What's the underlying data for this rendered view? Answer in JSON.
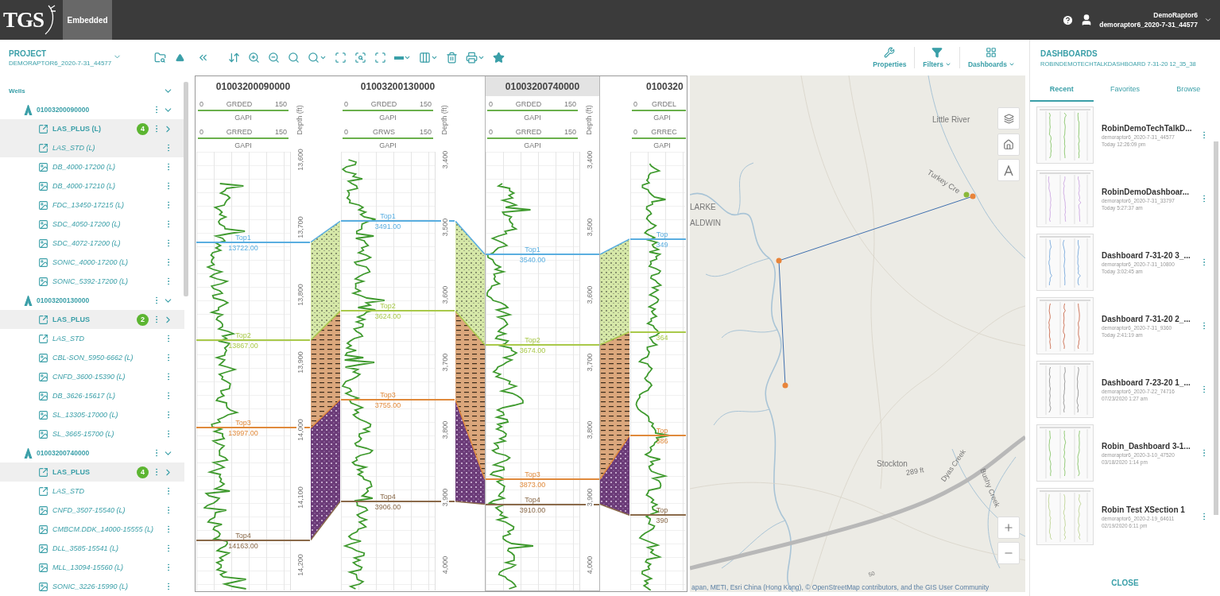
{
  "header": {
    "logo": "TGS",
    "tab": {
      "label": "Embedded",
      "selected": true
    },
    "user": {
      "name": "DemoRaptor6",
      "account": "demoraptor6_2020-7-31_44577"
    }
  },
  "sidebar": {
    "title": "PROJECT",
    "subtitle": "DEMORAPTOR6_2020-7-31_44577",
    "group": {
      "label": "Wells",
      "expanded": true
    },
    "wells": [
      {
        "name": "01003200090000",
        "expanded": true,
        "logs": [
          {
            "kind": "set",
            "label": "LAS_PLUS (L)",
            "badge": "4",
            "selected": true
          },
          {
            "kind": "las",
            "label": "LAS_STD (L)",
            "selected": true
          },
          {
            "kind": "image",
            "label": "DB_4000-17200 (L)",
            "selected": false
          },
          {
            "kind": "image",
            "label": "DB_4000-17210 (L)",
            "selected": false
          },
          {
            "kind": "image",
            "label": "FDC_13450-17215 (L)",
            "selected": false
          },
          {
            "kind": "image",
            "label": "SDC_4050-17200 (L)",
            "selected": false
          },
          {
            "kind": "image",
            "label": "SDC_4072-17200 (L)",
            "selected": false
          },
          {
            "kind": "image",
            "label": "SONIC_4000-17200 (L)",
            "selected": false
          },
          {
            "kind": "image",
            "label": "SONIC_5392-17200 (L)",
            "selected": false
          }
        ]
      },
      {
        "name": "01003200130000",
        "expanded": true,
        "logs": [
          {
            "kind": "set",
            "label": "LAS_PLUS",
            "badge": "2",
            "selected": true
          },
          {
            "kind": "las",
            "label": "LAS_STD",
            "selected": false
          },
          {
            "kind": "image",
            "label": "CBL-SON_5950-6662 (L)",
            "selected": false
          },
          {
            "kind": "image",
            "label": "CNFD_3600-15390 (L)",
            "selected": false
          },
          {
            "kind": "image",
            "label": "DB_3626-15617 (L)",
            "selected": false
          },
          {
            "kind": "image",
            "label": "SL_13305-17000 (L)",
            "selected": false
          },
          {
            "kind": "image",
            "label": "SL_3665-15700 (L)",
            "selected": false
          }
        ]
      },
      {
        "name": "01003200740000",
        "expanded": true,
        "logs": [
          {
            "kind": "set",
            "label": "LAS_PLUS",
            "badge": "4",
            "selected": true
          },
          {
            "kind": "las",
            "label": "LAS_STD",
            "selected": false
          },
          {
            "kind": "image",
            "label": "CNFD_3507-15540 (L)",
            "selected": false
          },
          {
            "kind": "image",
            "label": "CMBCM.DDK_14000-15555 (L)",
            "selected": false
          },
          {
            "kind": "image",
            "label": "DLL_3585-15541 (L)",
            "selected": false
          },
          {
            "kind": "image",
            "label": "MLL_13094-15560 (L)",
            "selected": false
          },
          {
            "kind": "image",
            "label": "SONIC_3226-15990 (L)",
            "selected": false
          }
        ]
      }
    ]
  },
  "toolbar": {
    "actions": [
      "Properties",
      "Filters",
      "Dashboards"
    ]
  },
  "cross_section": {
    "wells": [
      {
        "name": "01003200090000",
        "selected": false,
        "curves": [
          {
            "min": "0",
            "curve": "GRDED",
            "max": "150",
            "unit": "GAPI"
          },
          {
            "min": "0",
            "curve": "GRRED",
            "max": "150",
            "unit": "GAPI"
          }
        ],
        "depth_label": "Depth (ft)",
        "depth_ticks": [
          "13,600",
          "13,700",
          "13,800",
          "13,900",
          "14,000",
          "14,100",
          "14,200"
        ],
        "tops": [
          {
            "name": "Top1",
            "value": "13722.00",
            "color": "#5aaee0"
          },
          {
            "name": "Top2",
            "value": "13867.00",
            "color": "#a9c94a"
          },
          {
            "name": "Top3",
            "value": "13997.00",
            "color": "#e08a3c"
          },
          {
            "name": "Top4",
            "value": "14163.00",
            "color": "#8a6a4a"
          }
        ]
      },
      {
        "name": "01003200130000",
        "selected": false,
        "curves": [
          {
            "min": "0",
            "curve": "GRDED",
            "max": "150",
            "unit": "GAPI"
          },
          {
            "min": "0",
            "curve": "GRWS",
            "max": "150",
            "unit": "GAPI"
          }
        ],
        "depth_label": "Depth (ft)",
        "depth_ticks": [
          "3,400",
          "3,500",
          "3,600",
          "3,700",
          "3,800",
          "3,900",
          "4,000"
        ],
        "tops": [
          {
            "name": "Top1",
            "value": "3491.00",
            "color": "#5aaee0"
          },
          {
            "name": "Top2",
            "value": "3624.00",
            "color": "#a9c94a"
          },
          {
            "name": "Top3",
            "value": "3755.00",
            "color": "#e08a3c"
          },
          {
            "name": "Top4",
            "value": "3906.00",
            "color": "#8a6a4a"
          }
        ]
      },
      {
        "name": "01003200740000",
        "selected": true,
        "curves": [
          {
            "min": "0",
            "curve": "GRDED",
            "max": "150",
            "unit": "GAPI"
          },
          {
            "min": "0",
            "curve": "GRRED",
            "max": "150",
            "unit": "GAPI"
          }
        ],
        "depth_label": "Depth (ft)",
        "depth_ticks": [
          "3,400",
          "3,500",
          "3,600",
          "3,700",
          "3,800",
          "3,900",
          "4,000"
        ],
        "tops": [
          {
            "name": "Top1",
            "value": "3540.00",
            "color": "#5aaee0"
          },
          {
            "name": "Top2",
            "value": "3674.00",
            "color": "#a9c94a"
          },
          {
            "name": "Top3",
            "value": "3873.00",
            "color": "#e08a3c"
          },
          {
            "name": "Top4",
            "value": "3910.00",
            "color": "#8a6a4a"
          }
        ]
      },
      {
        "name": "0100320",
        "selected": false,
        "curves": [
          {
            "min": "0",
            "curve": "GRDEL",
            "unit": "GAPI"
          },
          {
            "min": "0",
            "curve": "GRREC",
            "unit": "GAPI"
          }
        ],
        "tops": [
          {
            "name": "Top",
            "value": "349",
            "color": "#5aaee0"
          },
          {
            "value": "364",
            "color": "#a9c94a"
          },
          {
            "name": "Top",
            "value": "386",
            "color": "#e08a3c"
          },
          {
            "name": "Top",
            "value": "390",
            "color": "#8a6a4a"
          }
        ]
      }
    ]
  },
  "map": {
    "labels": [
      "Little River",
      "Turkey Cre",
      "LARKE",
      "ALDWIN",
      "Stockton",
      "289 ft",
      "Dyas Creek",
      "Bushy Creek",
      "50"
    ],
    "markers": [
      {
        "color": "#e8843a"
      },
      {
        "color": "#e8843a"
      },
      {
        "color": "#e8843a"
      },
      {
        "color": "#8ab83a"
      }
    ],
    "attribution": "apan, METI, Esri China (Hong Kong), © OpenStreetMap contributors, and the GIS User Community"
  },
  "dashboards": {
    "title": "DASHBOARDS",
    "subtitle": "ROBINDEMOTECHTALKDASHBOARD 7-31-20 12_35_38",
    "tabs": [
      {
        "label": "Recent",
        "selected": true
      },
      {
        "label": "Favorites",
        "selected": false
      },
      {
        "label": "Browse",
        "selected": false
      }
    ],
    "items": [
      {
        "name": "RobinDemoTechTalkD...",
        "account": "demoraptor6_2020-7-31_44577",
        "time": "Today 12:26:09 pm"
      },
      {
        "name": "RobinDemoDashboar...",
        "account": "demoraptor6_2020-7-31_33797",
        "time": "Today 5:27:37 am"
      },
      {
        "name": "Dashboard 7-31-20 3_...",
        "account": "demoraptor6_2020-7-31_10800",
        "time": "Today 3:02:45 am"
      },
      {
        "name": "Dashboard 7-31-20 2_...",
        "account": "demoraptor6_2020-7-31_9360",
        "time": "Today 2:41:19 am"
      },
      {
        "name": "Dashboard 7-23-20 1_...",
        "account": "demoraptor6_2020-7-22_74716",
        "time": "07/23/2020 1:27 am"
      },
      {
        "name": "Robin_Dashboard 3-1...",
        "account": "demoraptor6_2020-3-10_47520",
        "time": "03/18/2020 1:14 pm"
      },
      {
        "name": "Robin Test XSection 1",
        "account": "demoraptor6_2020-2-19_64611",
        "time": "02/19/2020 6:11 pm"
      }
    ],
    "close": "CLOSE"
  }
}
